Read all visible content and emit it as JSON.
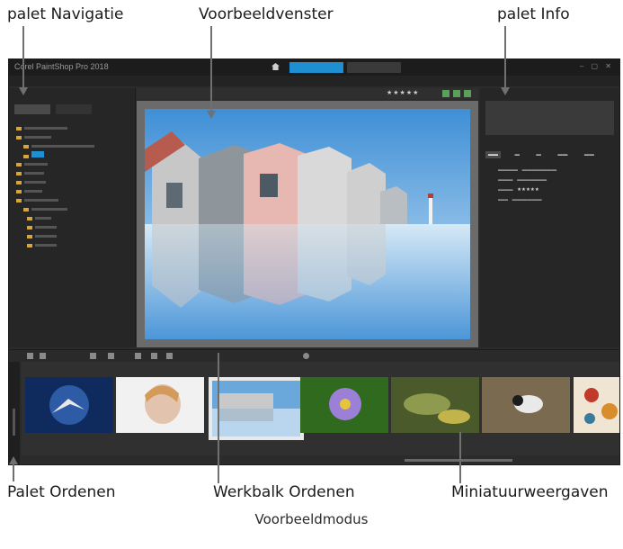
{
  "callouts": {
    "navigation": "palet Navigatie",
    "preview": "Voorbeeldvenster",
    "info": "palet Info",
    "organizer": "Palet Ordenen",
    "organizer_toolbar": "Werkbalk Ordenen",
    "thumbnails": "Miniatuurweergaven"
  },
  "caption": "Voorbeeldmodus",
  "app": {
    "title": "Corel PaintShop Pro 2018",
    "mode_tabs": [
      "",
      ""
    ],
    "stars": "★★★★★",
    "menu": [
      "",
      "",
      ""
    ]
  },
  "colors": {
    "accent": "#1e8fd0",
    "background": "#2b2b2b",
    "panel": "#262626"
  },
  "icons": [
    "home-icon",
    "folder-icon",
    "star-icon"
  ]
}
